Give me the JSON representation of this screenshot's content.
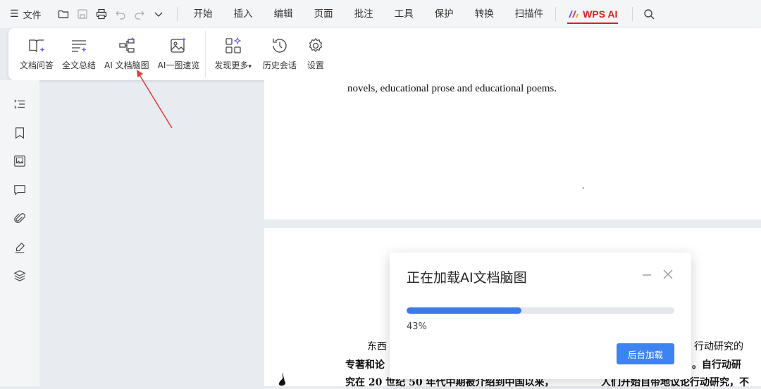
{
  "menubar": {
    "file_label": "文件",
    "tabs": [
      "开始",
      "插入",
      "编辑",
      "页面",
      "批注",
      "工具",
      "保护",
      "转换",
      "扫描件"
    ],
    "ai_tab": "WPS AI"
  },
  "ribbon": {
    "buttons": [
      "文档问答",
      "全文总结",
      "AI 文档脑图",
      "AI一图速览",
      "发现更多",
      "历史会话",
      "设置"
    ]
  },
  "document": {
    "page1_line": "novels, educational prose and educational poems.",
    "page2_lines": [
      "东西",
      "行动研究的",
      "专著和论",
      "。自行动研",
      "究在  20  世纪  50  年代中期被介绍到中国以来，",
      "人们开始自带地议论行动研究，不"
    ]
  },
  "dialog": {
    "title": "正在加载AI文档脑图",
    "progress": 0.43,
    "progress_text": "43%",
    "background_button": "后台加载"
  },
  "colors": {
    "accent_blue": "#3b7be9",
    "wps_ai_red": "#d92121"
  }
}
